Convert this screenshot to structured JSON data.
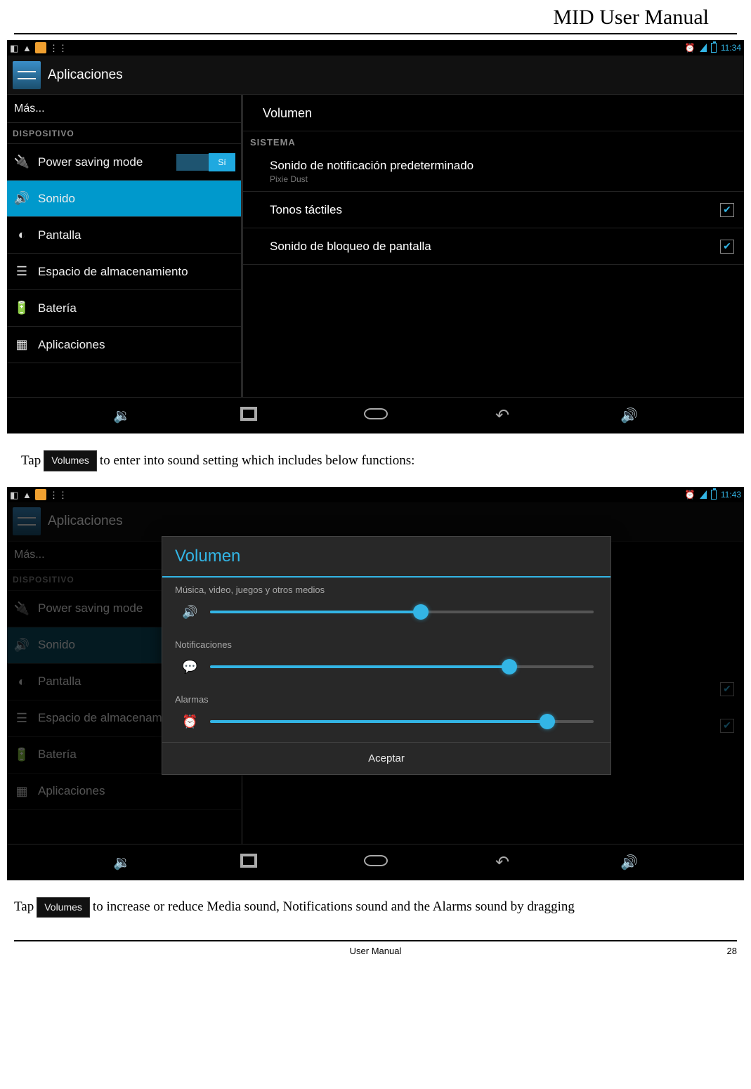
{
  "document": {
    "title": "MID User Manual",
    "footer_center": "User Manual",
    "page_number": "28",
    "instruction1_pre": "Tap",
    "instruction1_chip": "Volumes",
    "instruction1_post": "to enter into sound setting which includes below functions:",
    "instruction2_pre": "Tap",
    "instruction2_chip": "Volumes",
    "instruction2_post": "to increase or reduce Media sound, Notifications sound and the Alarms sound by dragging"
  },
  "screenshot1": {
    "time": "11:34",
    "app_title": "Aplicaciones",
    "sidebar": {
      "more": "Más...",
      "category": "DISPOSITIVO",
      "items": [
        {
          "label": "Power saving mode",
          "icon": "plug",
          "toggle": "Sí"
        },
        {
          "label": "Sonido",
          "icon": "volume",
          "selected": true
        },
        {
          "label": "Pantalla",
          "icon": "brightness"
        },
        {
          "label": "Espacio de almacenamiento",
          "icon": "storage"
        },
        {
          "label": "Batería",
          "icon": "battery"
        },
        {
          "label": "Aplicaciones",
          "icon": "apps"
        }
      ]
    },
    "content": {
      "title": "Volumen",
      "category": "SISTEMA",
      "rows": [
        {
          "main": "Sonido de notificación predeterminado",
          "sub": "Pixie Dust"
        },
        {
          "main": "Tonos táctiles",
          "checked": true
        },
        {
          "main": "Sonido de bloqueo de pantalla",
          "checked": true
        }
      ]
    }
  },
  "screenshot2": {
    "time": "11:43",
    "app_title": "Aplicaciones",
    "sidebar": {
      "more": "Más...",
      "category": "DISPOSITIVO",
      "items": [
        {
          "label": "Power saving mode",
          "icon": "plug"
        },
        {
          "label": "Sonido",
          "icon": "volume",
          "selected": true
        },
        {
          "label": "Pantalla",
          "icon": "brightness"
        },
        {
          "label": "Espacio de almacenamie",
          "icon": "storage"
        },
        {
          "label": "Batería",
          "icon": "battery"
        },
        {
          "label": "Aplicaciones",
          "icon": "apps"
        }
      ]
    },
    "dialog": {
      "title": "Volumen",
      "sliders": [
        {
          "label": "Música, video, juegos y otros medios",
          "icon": "volume",
          "value": 55
        },
        {
          "label": "Notificaciones",
          "icon": "notif",
          "value": 78
        },
        {
          "label": "Alarmas",
          "icon": "alarm",
          "value": 88
        }
      ],
      "accept": "Aceptar"
    }
  }
}
